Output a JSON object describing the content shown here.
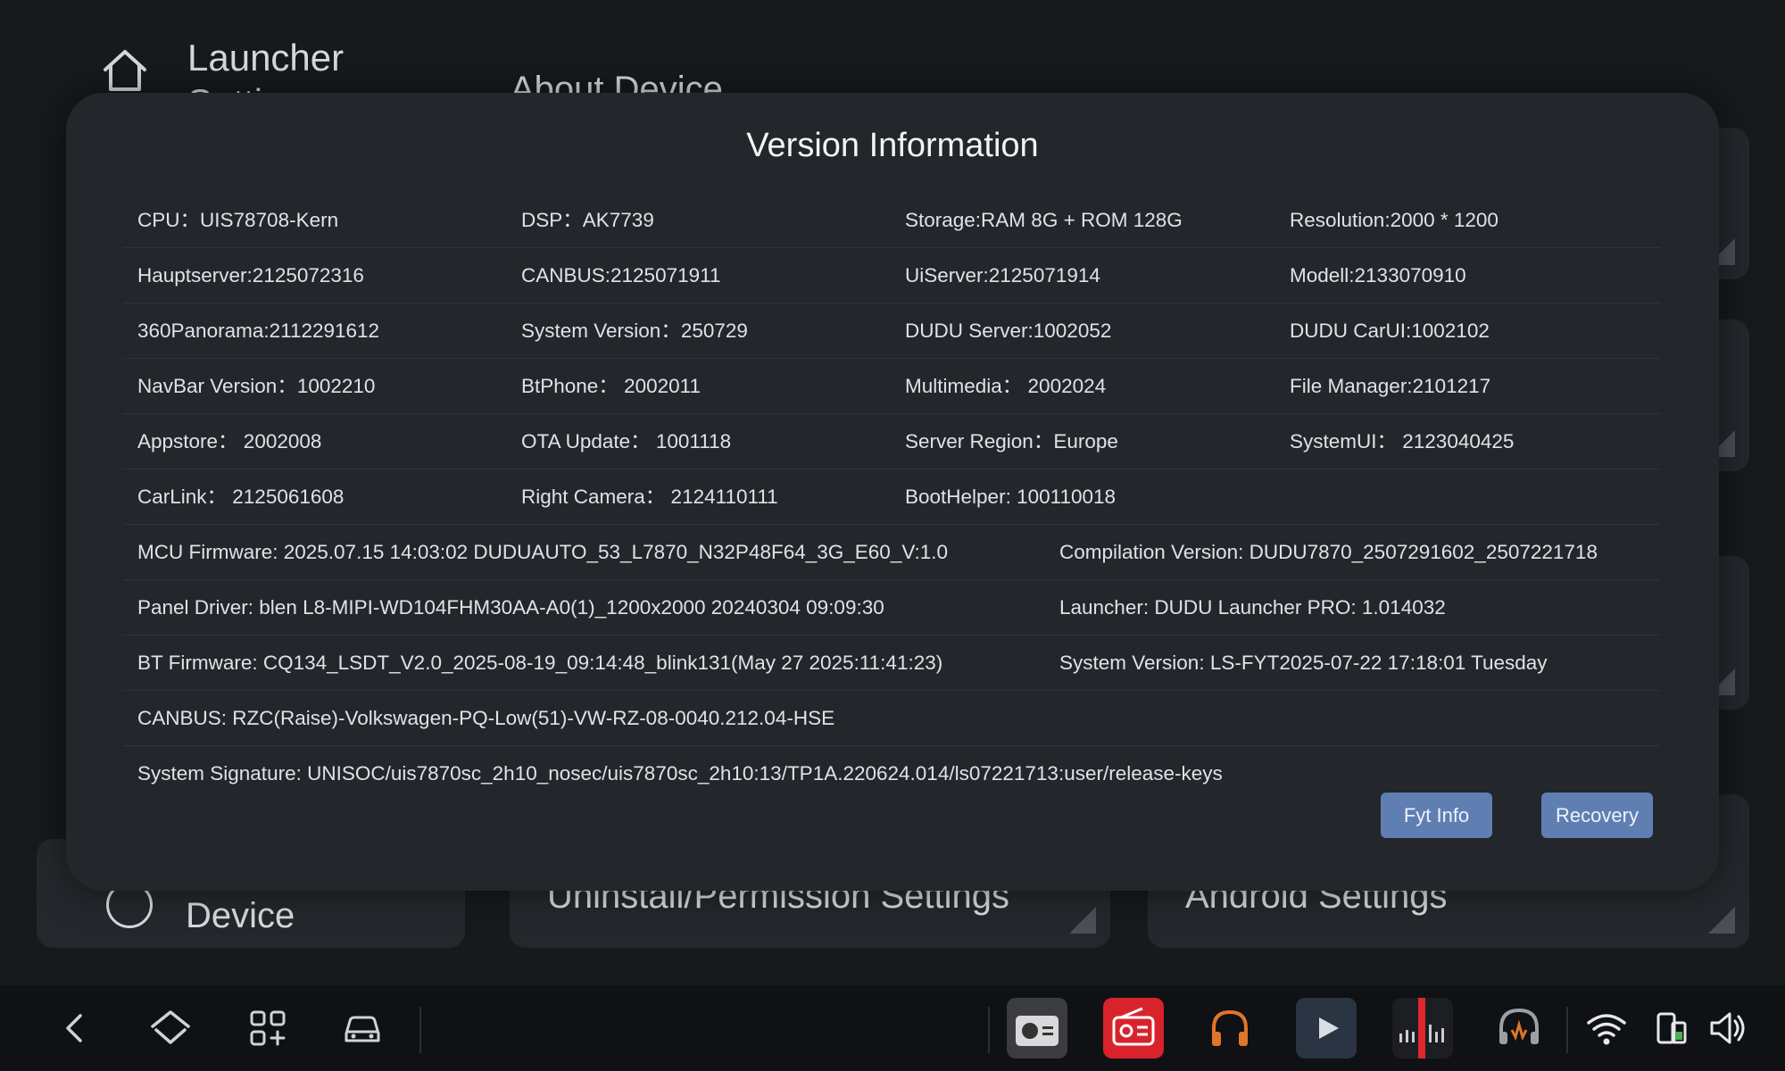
{
  "background": {
    "header_title_line1": "Launcher",
    "header_title_line2": "Settings",
    "section_title": "About Device",
    "cards": {
      "device": "Device",
      "uninstall": "Uninstall/Permission Settings",
      "android": "Android Settings"
    }
  },
  "modal": {
    "title": "Version Information",
    "grid_rows": [
      [
        "CPU：UIS78708-Kern",
        "DSP：AK7739",
        "Storage:RAM 8G + ROM 128G",
        "Resolution:2000 * 1200"
      ],
      [
        "Hauptserver:2125072316",
        "CANBUS:2125071911",
        "UiServer:2125071914",
        "Modell:2133070910"
      ],
      [
        "360Panorama:2112291612",
        "System Version：250729",
        "DUDU Server:1002052",
        "DUDU CarUI:1002102"
      ],
      [
        "NavBar Version：1002210",
        "BtPhone：  2002011",
        "Multimedia：  2002024",
        "File Manager:2101217"
      ],
      [
        "Appstore：  2002008",
        "OTA Update：  1001118",
        "Server Region：Europe",
        "SystemUI：  2123040425"
      ],
      [
        "CarLink：  2125061608",
        "Right Camera：  2124110111",
        "BootHelper: 100110018",
        ""
      ]
    ],
    "wide_rows": [
      [
        "MCU Firmware:  2025.07.15 14:03:02 DUDUAUTO_53_L7870_N32P48F64_3G_E60_V:1.0",
        "Compilation Version:  DUDU7870_2507291602_2507221718"
      ],
      [
        "Panel Driver:  blen L8-MIPI-WD104FHM30AA-A0(1)_1200x2000 20240304 09:09:30",
        "Launcher:  DUDU Launcher PRO: 1.014032"
      ],
      [
        "BT Firmware:  CQ134_LSDT_V2.0_2025-08-19_09:14:48_blink131(May 27 2025:11:41:23)",
        "System Version:  LS-FYT2025-07-22 17:18:01 Tuesday"
      ]
    ],
    "canbus_full": "CANBUS:  RZC(Raise)-Volkswagen-PQ-Low(51)-VW-RZ-08-0040.212.04-HSE",
    "system_signature": "System Signature:  UNISOC/uis7870sc_2h10_nosec/uis7870sc_2h10:13/TP1A.220624.014/ls07221713:user/release-keys",
    "buttons": {
      "fyt_info": "Fyt Info",
      "recovery": "Recovery"
    }
  },
  "navbar": {
    "left_icons": [
      "back-icon",
      "home-icon",
      "app-grid-icon",
      "car-icon"
    ],
    "apps": [
      "radio-icon",
      "fm-radio-icon",
      "headphones-icon",
      "video-player-icon",
      "equalizer-icon",
      "audio-icon"
    ],
    "status_icons": [
      "wifi-icon",
      "phone-battery-icon",
      "volume-icon"
    ],
    "colors": {
      "accent_red": "#e0262f",
      "button_blue": "#5f7fb3",
      "orange": "#e0752a"
    }
  }
}
